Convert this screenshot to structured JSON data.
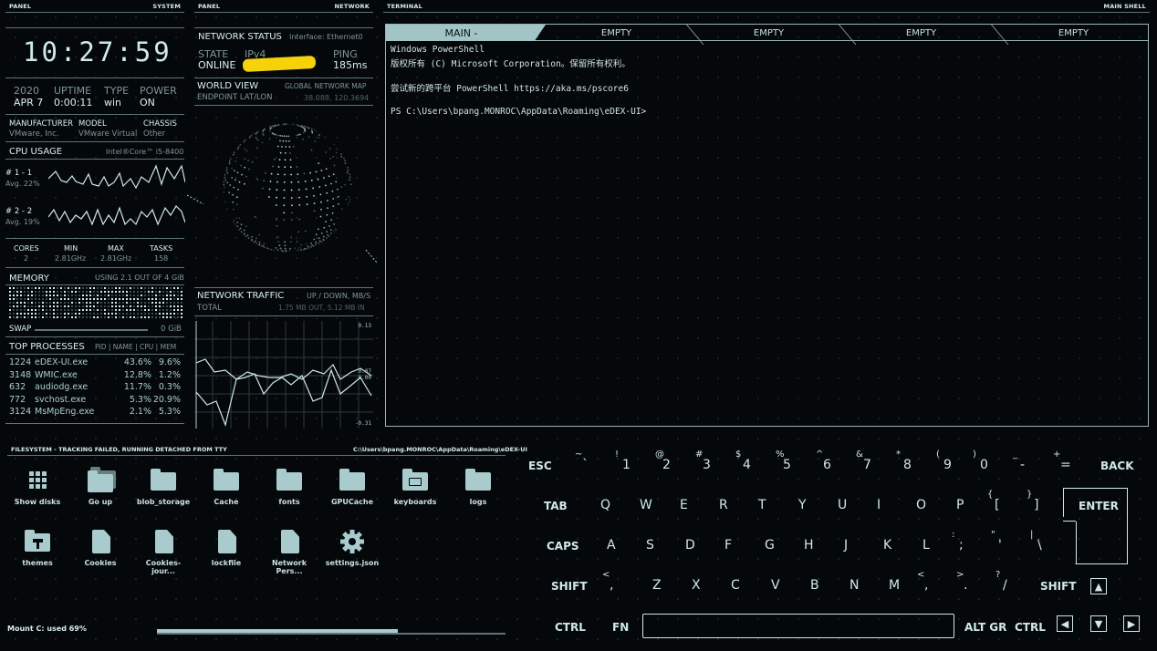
{
  "panel_system": {
    "left_label": "PANEL",
    "right_label": "SYSTEM"
  },
  "panel_network": {
    "left_label": "PANEL",
    "right_label": "NETWORK"
  },
  "panel_terminal": {
    "left_label": "TERMINAL",
    "right_label": "MAIN SHELL"
  },
  "clock": "10:27:59",
  "sysinfo": {
    "year": "2020",
    "date": "APR 7",
    "uptime_label": "UPTIME",
    "uptime": "0:00:11",
    "type_label": "TYPE",
    "type": "win",
    "power_label": "POWER",
    "power": "ON",
    "manufacturer_label": "MANUFACTURER",
    "manufacturer": "VMware, Inc.",
    "model_label": "MODEL",
    "model": "VMware Virtual",
    "chassis_label": "CHASSIS",
    "chassis": "Other"
  },
  "cpu": {
    "title": "CPU USAGE",
    "model": "Intel®Core™ i5-8400",
    "core1_label": "# 1 - 1",
    "core1_avg": "Avg. 22%",
    "core2_label": "# 2 - 2",
    "core2_avg": "Avg. 19%",
    "cores_label": "CORES",
    "cores": "2",
    "min_label": "MIN",
    "min": "2.81GHz",
    "max_label": "MAX",
    "max": "2.81GHz",
    "tasks_label": "TASKS",
    "tasks": "158"
  },
  "memory": {
    "title": "MEMORY",
    "usage": "USING 2.1 OUT OF 4 GiB",
    "swap_label": "SWAP",
    "swap_value": "0 GiB"
  },
  "processes": {
    "title": "TOP PROCESSES",
    "columns": "PID | NAME | CPU | MEM",
    "rows": [
      {
        "pid": "1224",
        "name": "eDEX-UI.exe",
        "cpu": "43.6%",
        "mem": "9.6%"
      },
      {
        "pid": "3148",
        "name": "WMIC.exe",
        "cpu": "12.8%",
        "mem": "1.2%"
      },
      {
        "pid": "632",
        "name": "audiodg.exe",
        "cpu": "11.7%",
        "mem": "0.3%"
      },
      {
        "pid": "772",
        "name": "svchost.exe",
        "cpu": "5.3%",
        "mem": "20.9%"
      },
      {
        "pid": "3124",
        "name": "MsMpEng.exe",
        "cpu": "2.1%",
        "mem": "5.3%"
      }
    ]
  },
  "network_status": {
    "title": "NETWORK STATUS",
    "interface": "Interface: Ethernet0",
    "state_label": "STATE",
    "state": "ONLINE",
    "ipv4_label": "IPv4",
    "ping_label": "PING",
    "ping": "185ms"
  },
  "world_view": {
    "title": "WORLD VIEW",
    "subtitle": "GLOBAL NETWORK MAP",
    "endpoint_label": "ENDPOINT LAT/LON",
    "endpoint": "38.088, 120.3694"
  },
  "traffic": {
    "title": "NETWORK TRAFFIC",
    "units": "UP / DOWN, MB/S",
    "total_label": "TOTAL",
    "total": "1.75 MB OUT, 5.12 MB IN",
    "tick_top": "0.13",
    "tick_mid1": "0.07",
    "tick_mid2": "0.00",
    "tick_bottom": "-0.31"
  },
  "terminal": {
    "tabs": [
      "MAIN -",
      "EMPTY",
      "EMPTY",
      "EMPTY",
      "EMPTY"
    ],
    "lines": [
      "Windows PowerShell",
      "版权所有 (C) Microsoft Corporation。保留所有权利。",
      "",
      "尝试新的跨平台 PowerShell https://aka.ms/pscore6",
      "",
      "PS C:\\Users\\bpang.MONROC\\AppData\\Roaming\\eDEX-UI>"
    ]
  },
  "filesystem": {
    "title": "FILESYSTEM - TRACKING FAILED, RUNNING DETACHED FROM TTY",
    "path": "C:\\Users\\bpang.MONROC\\AppData\\Roaming\\eDEX-UI",
    "items": [
      {
        "label": "Show disks",
        "icon": "grid-icon"
      },
      {
        "label": "Go up",
        "icon": "folder-up-icon"
      },
      {
        "label": "blob_storage",
        "icon": "folder-icon"
      },
      {
        "label": "Cache",
        "icon": "folder-icon"
      },
      {
        "label": "fonts",
        "icon": "folder-icon"
      },
      {
        "label": "GPUCache",
        "icon": "folder-icon"
      },
      {
        "label": "keyboards",
        "icon": "keyboard-folder-icon"
      },
      {
        "label": "logs",
        "icon": "folder-icon"
      },
      {
        "label": "themes",
        "icon": "themes-folder-icon"
      },
      {
        "label": "Cookies",
        "icon": "file-icon"
      },
      {
        "label": "Cookies-jour...",
        "icon": "file-icon"
      },
      {
        "label": "lockfile",
        "icon": "file-icon"
      },
      {
        "label": "Network Pers...",
        "icon": "file-icon"
      },
      {
        "label": "settings.json",
        "icon": "gear-icon"
      }
    ],
    "mount_label": "Mount C: used 69%",
    "mount_used_fraction": 0.69
  },
  "keyboard": {
    "row1": [
      [
        "ESC",
        ""
      ],
      [
        "~",
        "`"
      ],
      [
        "!",
        "1"
      ],
      [
        "@",
        "2"
      ],
      [
        "#",
        "3"
      ],
      [
        "$",
        "4"
      ],
      [
        "%",
        "5"
      ],
      [
        "^",
        "6"
      ],
      [
        "&",
        "7"
      ],
      [
        "*",
        "8"
      ],
      [
        "(",
        "9"
      ],
      [
        ")",
        "0"
      ],
      [
        "_",
        "-"
      ],
      [
        "+",
        "="
      ],
      [
        "BACK",
        ""
      ]
    ],
    "row2": [
      "TAB",
      "Q",
      "W",
      "E",
      "R",
      "T",
      "Y",
      "U",
      "I",
      "O",
      "P"
    ],
    "row2_extra": [
      [
        "{",
        "["
      ],
      [
        "}",
        "]"
      ]
    ],
    "enter": "ENTER",
    "row3": [
      "CAPS",
      "A",
      "S",
      "D",
      "F",
      "G",
      "H",
      "J",
      "K",
      "L"
    ],
    "row3_extra": [
      [
        ":",
        ";"
      ],
      [
        "\"",
        "'"
      ],
      [
        "|",
        "\\"
      ]
    ],
    "row4": [
      "SHIFT",
      "Z",
      "X",
      "C",
      "V",
      "B",
      "N",
      "M"
    ],
    "row4_extra": [
      [
        "<",
        ","
      ],
      [
        ">",
        "."
      ],
      [
        "?",
        "/"
      ]
    ],
    "shift_right": "SHIFT",
    "row5": {
      "ctrl": "CTRL",
      "fn": "FN",
      "altgr": "ALT GR",
      "ctrl_right": "CTRL"
    },
    "arrows": {
      "up": "▲",
      "left": "◀",
      "down": "▼",
      "right": "▶"
    }
  }
}
